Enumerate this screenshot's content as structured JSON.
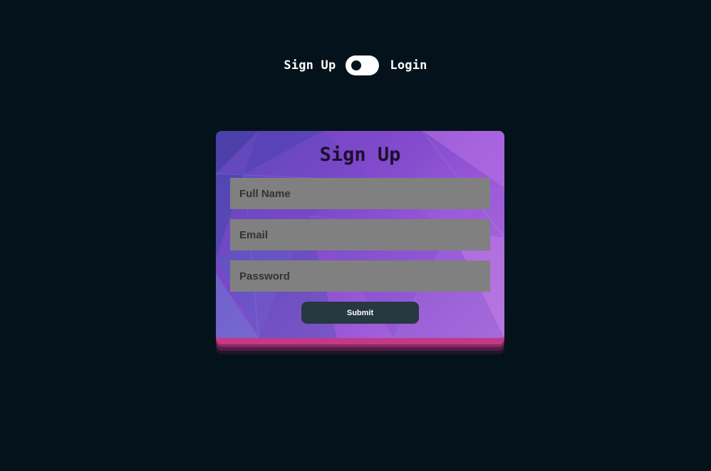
{
  "toggle": {
    "left_label": "Sign Up",
    "right_label": "Login"
  },
  "form": {
    "title": "Sign Up",
    "fields": [
      {
        "placeholder": "Full Name",
        "value": ""
      },
      {
        "placeholder": "Email",
        "value": ""
      },
      {
        "placeholder": "Password",
        "value": ""
      }
    ],
    "submit_label": "Submit"
  },
  "colors": {
    "page_background": "#04131b",
    "card_gradient_start": "#5a48b8",
    "card_gradient_end": "#b070e0",
    "card_edge": "#c23a86",
    "field_background": "#808080",
    "button_background": "#263840"
  }
}
